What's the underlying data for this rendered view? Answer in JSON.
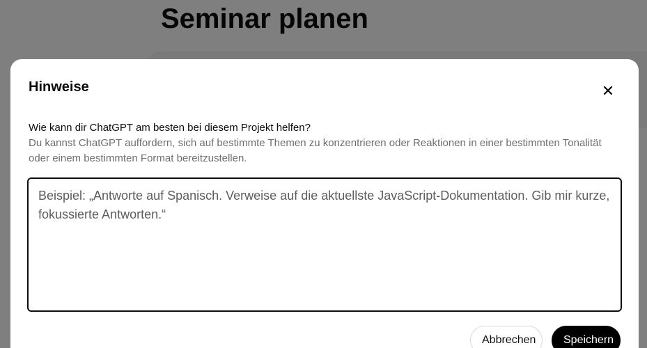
{
  "background": {
    "page_title": "Seminar planen"
  },
  "modal": {
    "title": "Hinweise",
    "close_icon": "close-icon",
    "question": "Wie kann dir ChatGPT am besten bei diesem Projekt helfen?",
    "help_text": "Du kannst ChatGPT auffordern, sich auf bestimmte Themen zu konzentrieren oder Reaktionen in einer bestimmten Tonalität oder einem bestimmten Format bereitzustellen.",
    "instructions_value": "",
    "instructions_placeholder": "Beispiel: „Antworte auf Spanisch. Verweise auf die aktuellste JavaScript-Dokumentation. Gib mir kurze, fokussierte Antworten.“",
    "cancel_label": "Abbrechen",
    "save_label": "Speichern"
  },
  "colors": {
    "overlay": "#000000",
    "primary_button": "#000000",
    "text": "#0d0d0d",
    "secondary_text": "#6e6e6e"
  }
}
